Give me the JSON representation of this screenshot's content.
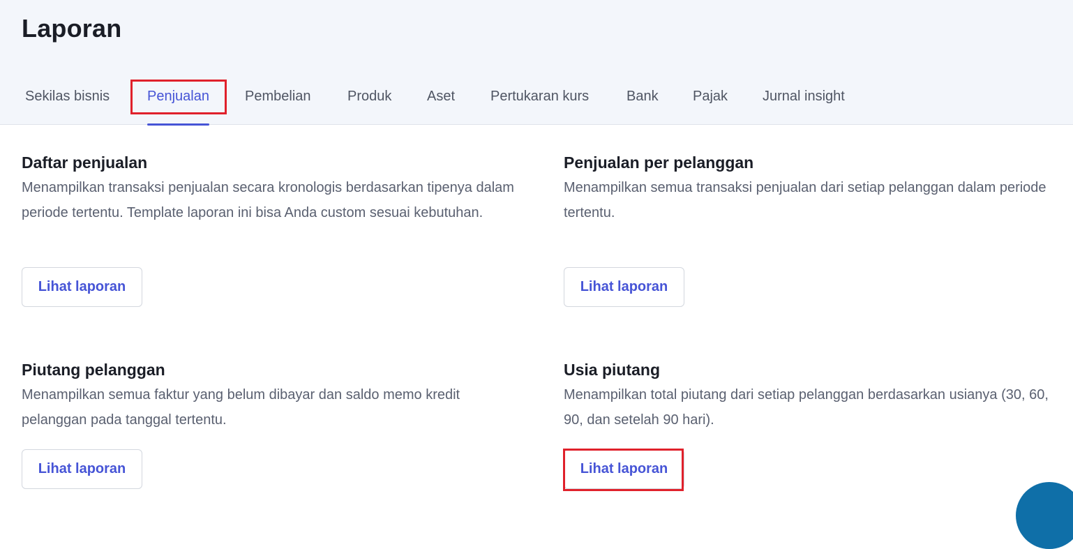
{
  "page": {
    "title": "Laporan"
  },
  "tabs": [
    {
      "label": "Sekilas bisnis",
      "active": false
    },
    {
      "label": "Penjualan",
      "active": true
    },
    {
      "label": "Pembelian",
      "active": false
    },
    {
      "label": "Produk",
      "active": false
    },
    {
      "label": "Aset",
      "active": false
    },
    {
      "label": "Pertukaran kurs",
      "active": false
    },
    {
      "label": "Bank",
      "active": false
    },
    {
      "label": "Pajak",
      "active": false
    },
    {
      "label": "Jurnal insight",
      "active": false
    }
  ],
  "reports": [
    {
      "title": "Daftar penjualan",
      "description": "Menampilkan transaksi penjualan secara kronologis berdasarkan tipenya dalam periode tertentu. Template laporan ini bisa Anda custom sesuai kebutuhan.",
      "button_label": "Lihat laporan"
    },
    {
      "title": "Penjualan per pelanggan",
      "description": "Menampilkan semua transaksi penjualan dari setiap pelanggan dalam periode tertentu.",
      "button_label": "Lihat laporan"
    },
    {
      "title": "Piutang pelanggan",
      "description": "Menampilkan semua faktur yang belum dibayar dan saldo memo kredit pelanggan pada tanggal tertentu.",
      "button_label": "Lihat laporan"
    },
    {
      "title": "Usia piutang",
      "description": "Menampilkan total piutang dari setiap pelanggan berdasarkan usianya (30, 60, 90, dan setelah 90 hari).",
      "button_label": "Lihat laporan"
    }
  ],
  "colors": {
    "accent": "#4654d6",
    "highlight": "#e0212b",
    "header_bg": "#f3f6fb",
    "fab": "#0f6fa8"
  }
}
